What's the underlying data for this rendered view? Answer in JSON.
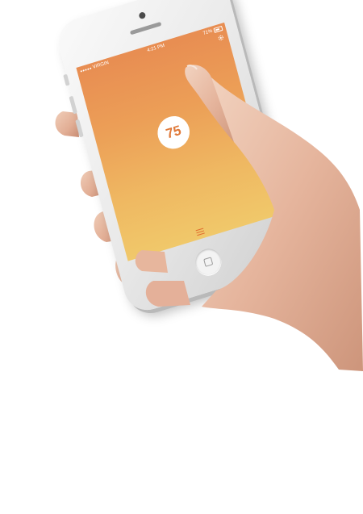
{
  "status_bar": {
    "carrier": "VIRGIN",
    "time": "4:21 PM",
    "battery_percent": "71%"
  },
  "app": {
    "score": "75",
    "gradient_top": "#e88d52",
    "gradient_bottom": "#f0c86a",
    "accent": "#e07a3b"
  },
  "icons": {
    "settings": "gear-icon",
    "menu": "menu-icon",
    "home": "home-button-icon"
  }
}
